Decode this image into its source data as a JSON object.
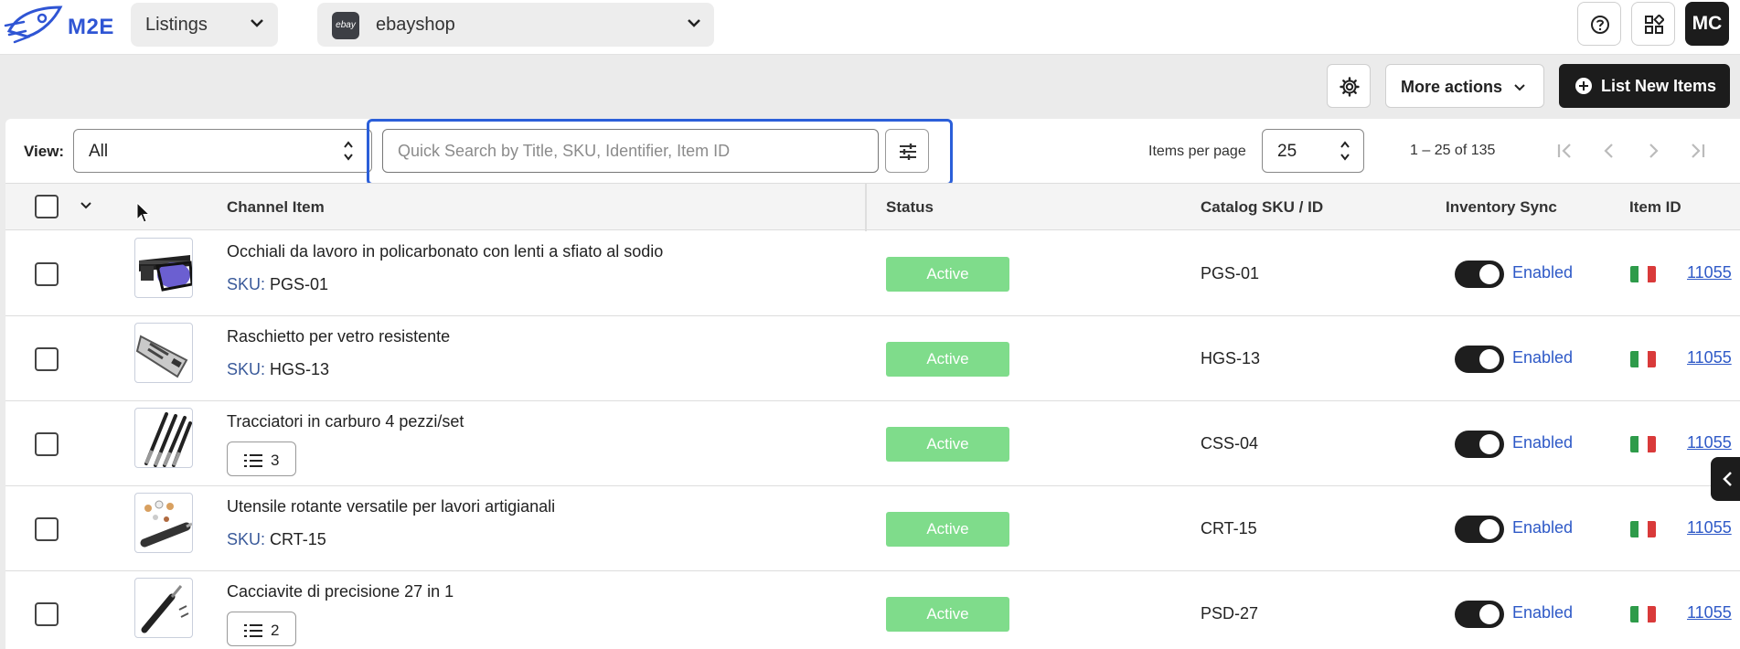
{
  "brand": {
    "name": "M2E",
    "accent": "#2f55d4"
  },
  "topbar": {
    "section_select": "Listings",
    "account_select": "ebayshop",
    "account_logo": "ebay",
    "help_icon": "help-circle-icon",
    "apps_icon": "apps-grid-icon",
    "avatar_initials": "MC"
  },
  "actions": {
    "more_actions_label": "More actions",
    "list_new_label": "List New Items"
  },
  "filters": {
    "view_label": "View:",
    "view_value": "All",
    "search_placeholder": "Quick Search by Title, SKU, Identifier, Item ID",
    "items_per_page_label": "Items per page",
    "items_per_page_value": "25",
    "range_text": "1 – 25 of 135"
  },
  "table": {
    "columns": {
      "channel_item": "Channel Item",
      "status": "Status",
      "catalog_sku": "Catalog SKU / ID",
      "inventory_sync": "Inventory Sync",
      "item_id": "Item ID"
    },
    "sku_key": "SKU:",
    "rows": [
      {
        "title": "Occhiali da lavoro in policarbonato con lenti a sfiato al sodio",
        "sku": "PGS-01",
        "variations": null,
        "status": "Active",
        "catalog_sku": "PGS-01",
        "sync": "Enabled",
        "item_id": "11055"
      },
      {
        "title": "Raschietto per vetro resistente",
        "sku": "HGS-13",
        "variations": null,
        "status": "Active",
        "catalog_sku": "HGS-13",
        "sync": "Enabled",
        "item_id": "11055"
      },
      {
        "title": "Tracciatori in carburo 4 pezzi/set",
        "sku": null,
        "variations": "3",
        "status": "Active",
        "catalog_sku": "CSS-04",
        "sync": "Enabled",
        "item_id": "11055"
      },
      {
        "title": "Utensile rotante versatile per lavori artigianali",
        "sku": "CRT-15",
        "variations": null,
        "status": "Active",
        "catalog_sku": "CRT-15",
        "sync": "Enabled",
        "item_id": "11055"
      },
      {
        "title": "Cacciavite di precisione 27 in 1",
        "sku": null,
        "variations": "2",
        "status": "Active",
        "catalog_sku": "PSD-27",
        "sync": "Enabled",
        "item_id": "11055"
      }
    ]
  },
  "colors": {
    "status_active": "#7fdc8b",
    "link": "#2e59c7",
    "highlight": "#2b5fd9"
  }
}
